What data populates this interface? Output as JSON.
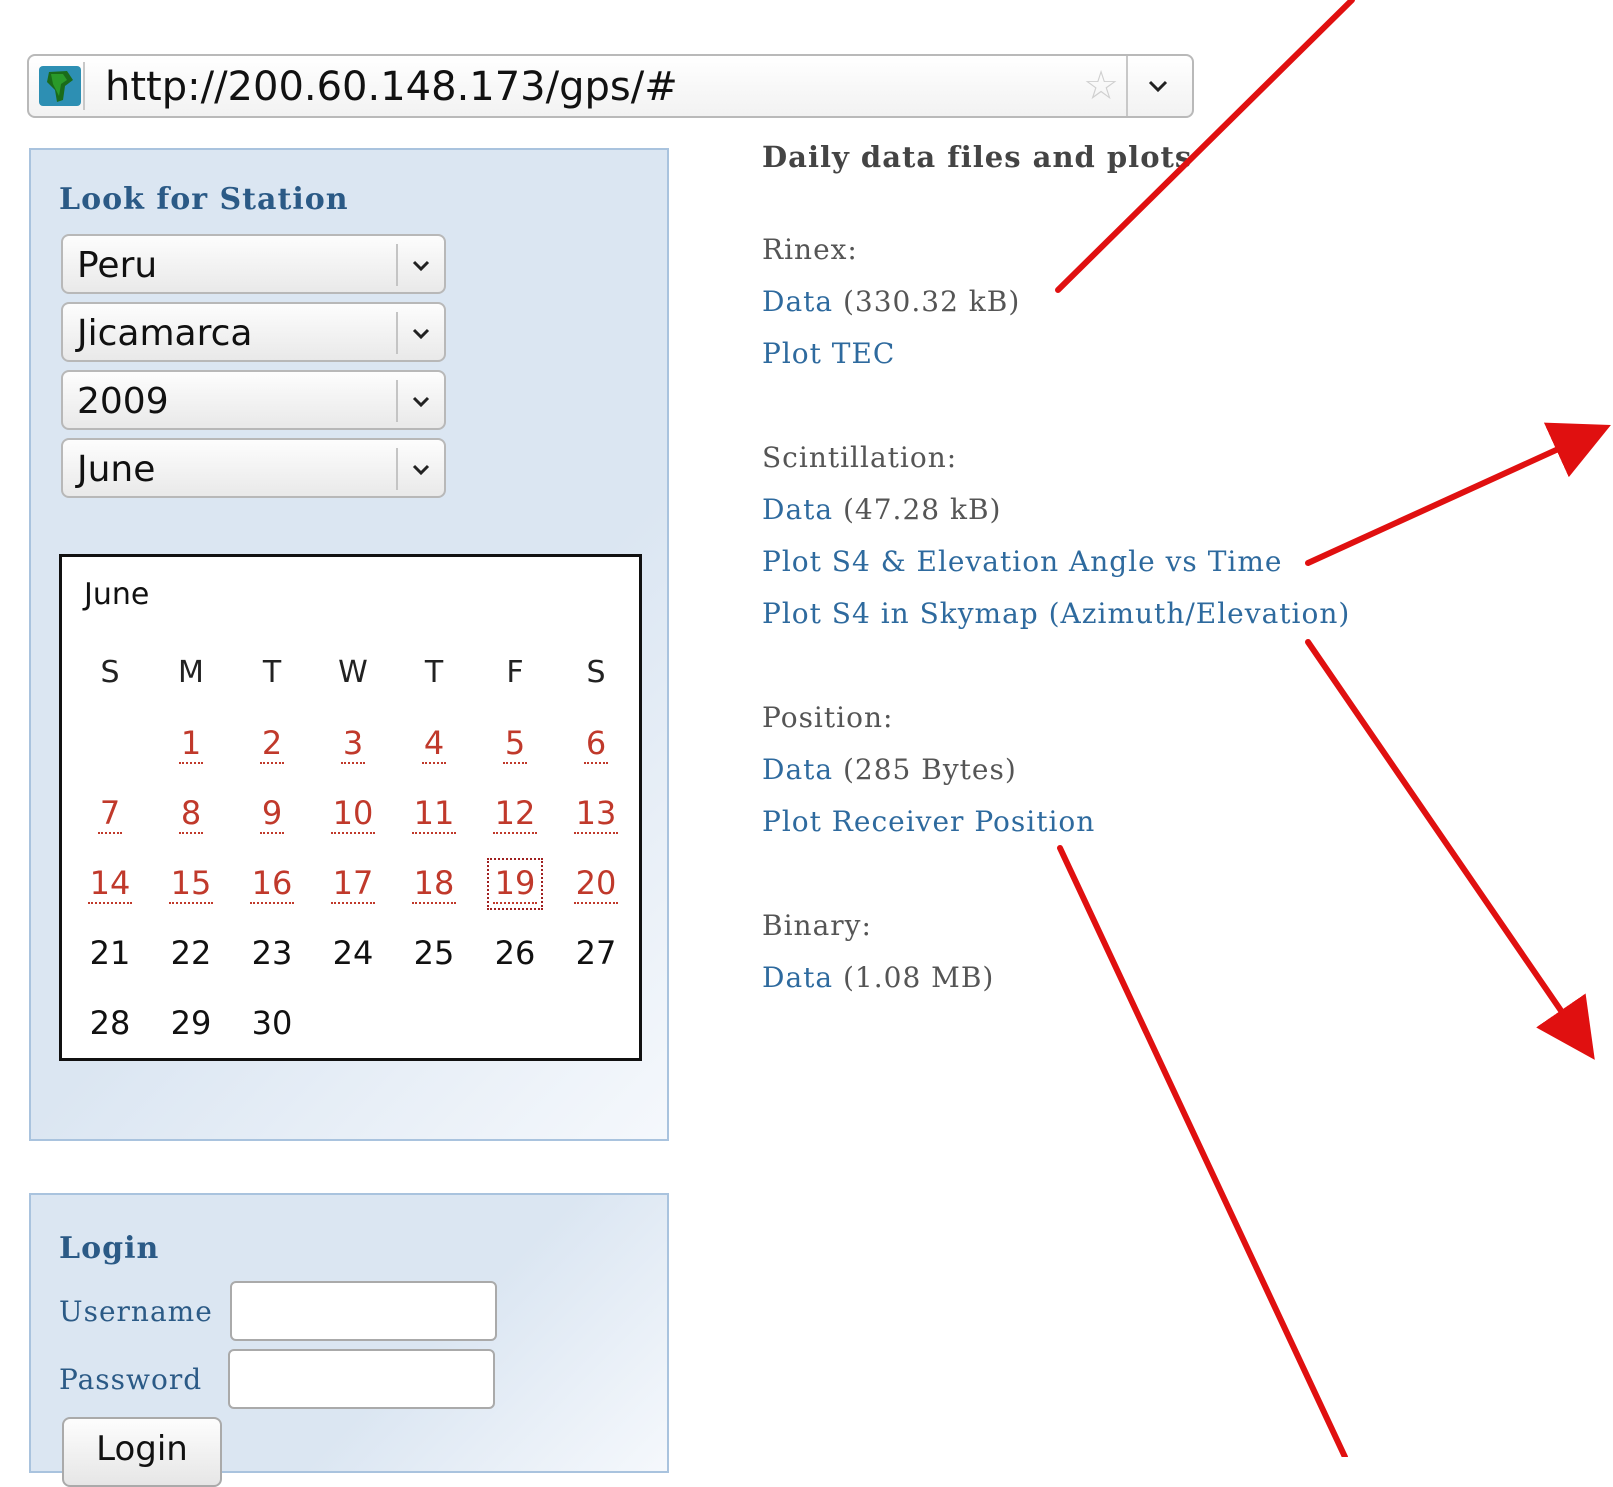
{
  "url_bar": {
    "url": "http://200.60.148.173/gps/#",
    "favicon": "south-america-globe-icon",
    "star": "☆"
  },
  "station_panel": {
    "title": "Look for Station",
    "selects": {
      "country": "Peru",
      "station": "Jicamarca",
      "year": "2009",
      "month": "June"
    }
  },
  "calendar": {
    "month_label": "June",
    "days_of_week": [
      "S",
      "M",
      "T",
      "W",
      "T",
      "F",
      "S"
    ],
    "linked_days": [
      1,
      2,
      3,
      4,
      5,
      6,
      7,
      8,
      9,
      10,
      11,
      12,
      13,
      14,
      15,
      16,
      17,
      18,
      19,
      20
    ],
    "selected_day": 19,
    "plain_days": [
      21,
      22,
      23,
      24,
      25,
      26,
      27,
      28,
      29,
      30
    ]
  },
  "login_panel": {
    "title": "Login",
    "username_label": "Username",
    "password_label": "Password",
    "button_label": "Login",
    "username_value": "",
    "password_value": ""
  },
  "daily": {
    "heading": "Daily data files and plots",
    "rinex": {
      "label": "Rinex:",
      "data_link": "Data",
      "data_size": "(330.32 kB)",
      "plot_tec": "Plot TEC"
    },
    "scintillation": {
      "label": "Scintillation:",
      "data_link": "Data",
      "data_size": "(47.28 kB)",
      "plot_elev": "Plot S4 & Elevation Angle vs Time",
      "plot_skymap": "Plot S4 in Skymap (Azimuth/Elevation)"
    },
    "position": {
      "label": "Position:",
      "data_link": "Data",
      "data_size": "(285 Bytes)",
      "plot_receiver": "Plot Receiver Position"
    },
    "binary": {
      "label": "Binary:",
      "data_link": "Data",
      "data_size": "(1.08 MB)"
    }
  },
  "colors": {
    "panel_border": "#a9c3de",
    "panel_title": "#2b5a86",
    "link": "#2e6a9e",
    "calendar_link": "#c0392b",
    "annotation_arrow": "#e01010"
  }
}
